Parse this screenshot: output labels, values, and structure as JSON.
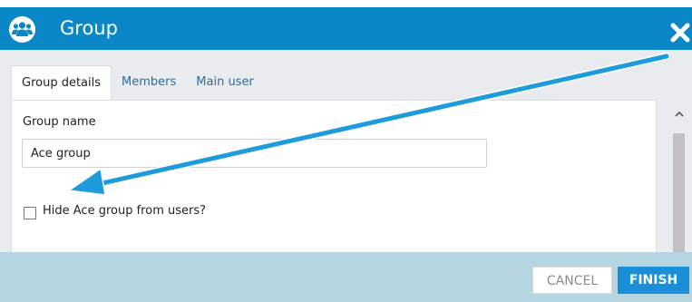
{
  "dialog": {
    "title": "Group",
    "title_icon": "group-icon",
    "close_icon": "close-icon"
  },
  "tabs": [
    {
      "label": "Group details",
      "active": true
    },
    {
      "label": "Members",
      "active": false
    },
    {
      "label": "Main user",
      "active": false
    }
  ],
  "form": {
    "group_name_label": "Group name",
    "group_name_value": "Ace group",
    "hide_checkbox_label": "Hide Ace group from users?",
    "hide_checkbox_checked": false
  },
  "footer": {
    "cancel_label": "CANCEL",
    "finish_label": "FINISH"
  },
  "colors": {
    "titlebar": "#0a87c6",
    "footer": "#b5d5e0",
    "finish_button": "#1a8fd8",
    "annotation_arrow": "#1e9bdc"
  }
}
